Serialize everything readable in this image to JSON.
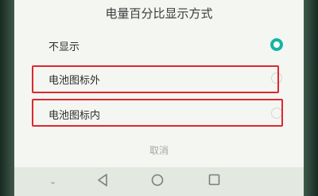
{
  "dialog": {
    "title": "电量百分比显示方式",
    "options": [
      {
        "label": "不显示",
        "selected": true
      },
      {
        "label": "电池图标外",
        "selected": false
      },
      {
        "label": "电池图标内",
        "selected": false
      }
    ],
    "cancel_label": "取消"
  },
  "navbar": {
    "dropdown_icon": "chevron-down-icon",
    "back_icon": "back-triangle-icon",
    "home_icon": "home-circle-icon",
    "recent_icon": "recent-apps-square-icon"
  },
  "colors": {
    "accent": "#14b6a2",
    "highlight": "#e0272f"
  }
}
